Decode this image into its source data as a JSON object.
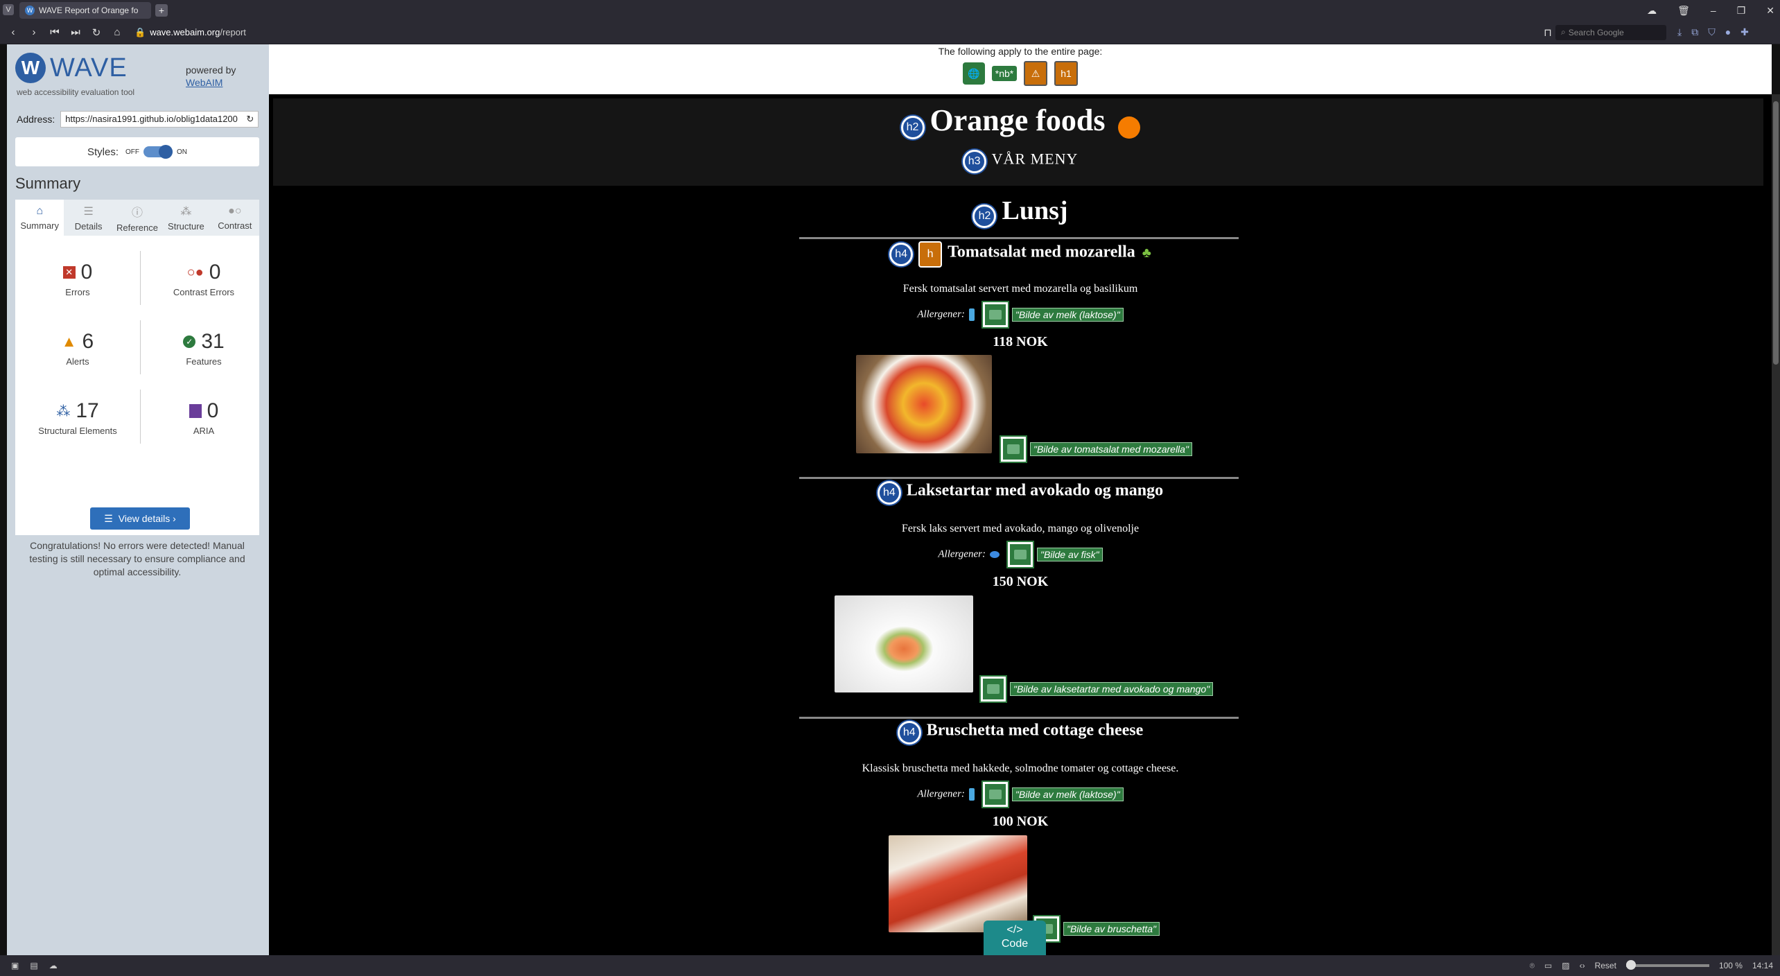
{
  "browser": {
    "tab_title": "WAVE Report of Orange fo",
    "url_domain": "wave.webaim.org",
    "url_path": "/report",
    "search_placeholder": "Search Google",
    "zoom": "100 %",
    "zoom_reset": "Reset",
    "time": "14:14"
  },
  "sidebar": {
    "logo_text": "WAVE",
    "tagline": "web accessibility evaluation tool",
    "powered_by": "powered by",
    "webaim_link": "WebAIM",
    "address_label": "Address:",
    "address_value": "https://nasira1991.github.io/oblig1data1200",
    "styles_label": "Styles:",
    "styles_off": "OFF",
    "styles_on": "ON",
    "summary_heading": "Summary",
    "tabs": [
      {
        "label": "Summary",
        "icon": "home-icon"
      },
      {
        "label": "Details",
        "icon": "list-icon"
      },
      {
        "label": "Reference",
        "icon": "info-icon"
      },
      {
        "label": "Structure",
        "icon": "structure-icon"
      },
      {
        "label": "Contrast",
        "icon": "contrast-icon"
      }
    ],
    "stats": [
      {
        "value": "0",
        "label": "Errors"
      },
      {
        "value": "0",
        "label": "Contrast Errors"
      },
      {
        "value": "6",
        "label": "Alerts"
      },
      {
        "value": "31",
        "label": "Features"
      },
      {
        "value": "17",
        "label": "Structural Elements"
      },
      {
        "value": "0",
        "label": "ARIA"
      }
    ],
    "view_details": "View details ›",
    "congrats": "Congratulations! No errors were detected! Manual testing is still necessary to ensure compliance and optimal accessibility."
  },
  "page_top": {
    "applies_text": "The following apply to the entire page:",
    "nb_label": "*nb*",
    "h1_label": "h1"
  },
  "content": {
    "title": "Orange foods",
    "subtitle": "VÅR MENY",
    "section": "Lunsj",
    "h2_badge": "h2",
    "h3_badge": "h3",
    "h4_badge": "h4",
    "allergen_label": "Allergener:",
    "items": [
      {
        "name": "Tomatsalat med mozarella",
        "desc": "Fersk tomatsalat servert med mozarella og basilikum",
        "allergen_alt": "\"Bilde av melk (laktose)\"",
        "price": "118 NOK",
        "image_alt": "\"Bilde av tomatsalat med mozarella\""
      },
      {
        "name": "Laksetartar med avokado og mango",
        "desc": "Fersk laks servert med avokado, mango og olivenolje",
        "allergen_alt": "\"Bilde av fisk\"",
        "price": "150 NOK",
        "image_alt": "\"Bilde av laksetartar med avokado og mango\""
      },
      {
        "name": "Bruschetta med cottage cheese",
        "desc": "Klassisk bruschetta med hakkede, solmodne tomater og cottage cheese.",
        "allergen_alt": "\"Bilde av melk (laktose)\"",
        "price": "100 NOK",
        "image_alt": "\"Bilde av bruschetta\""
      }
    ],
    "code_label": "Code"
  },
  "colors": {
    "wave_blue": "#2e5fa3",
    "feature_green": "#2d7a3e",
    "alert_orange": "#c86e0a"
  }
}
